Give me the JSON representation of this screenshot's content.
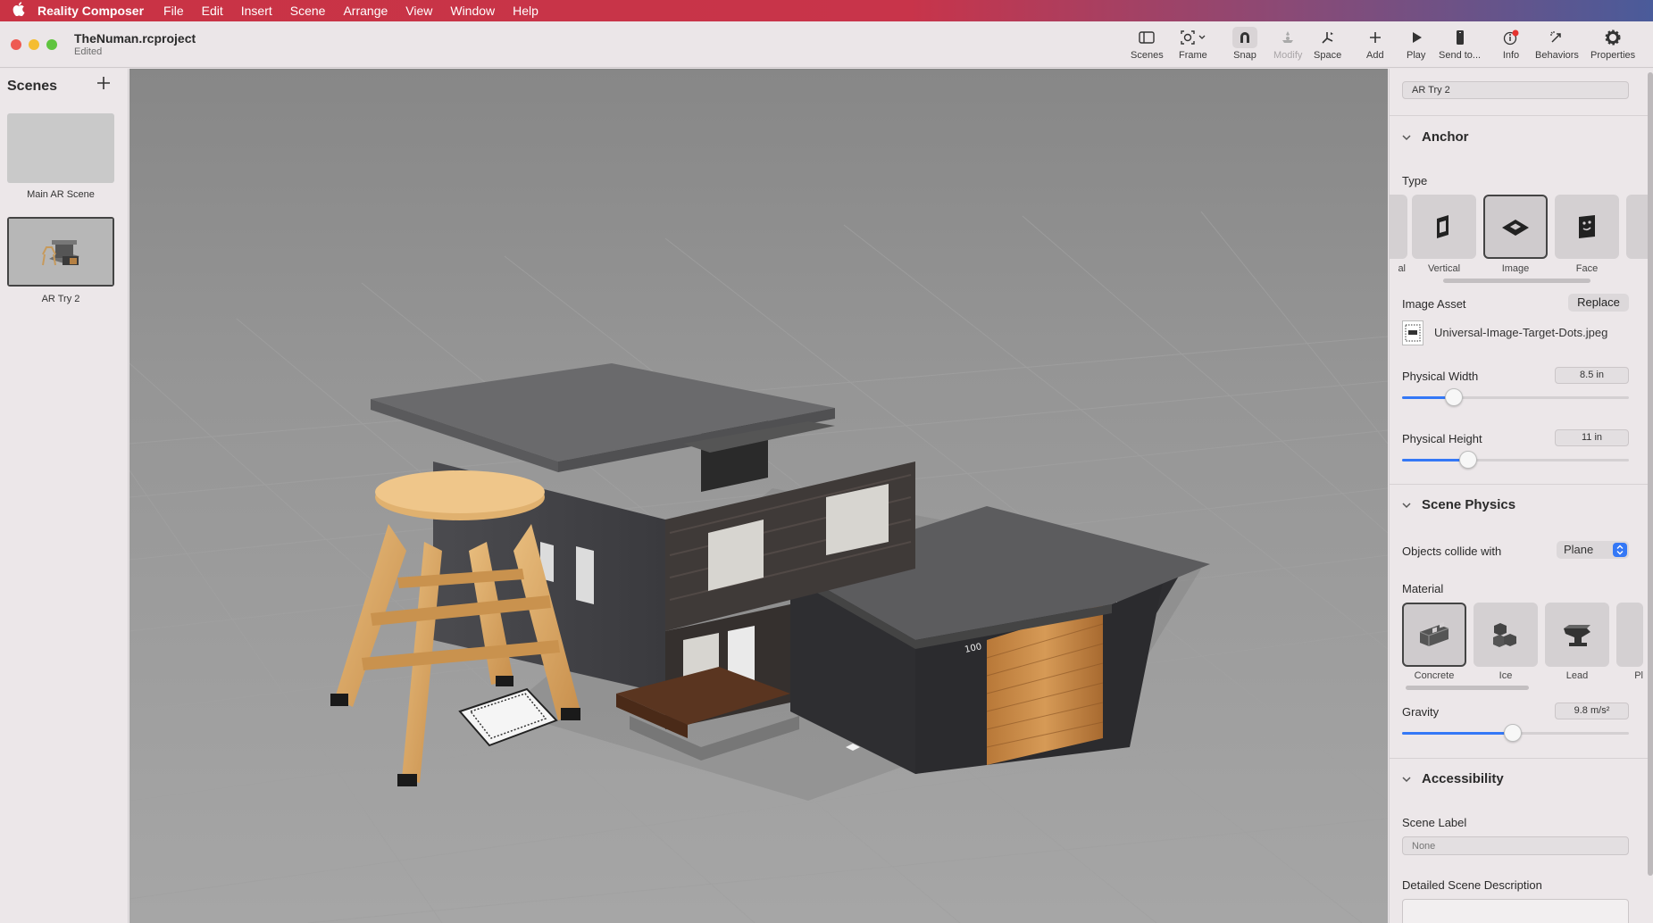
{
  "menubar": {
    "app_name": "Reality Composer",
    "items": [
      "File",
      "Edit",
      "Insert",
      "Scene",
      "Arrange",
      "View",
      "Window",
      "Help"
    ]
  },
  "window": {
    "title": "TheNuman.rcproject",
    "subtitle": "Edited"
  },
  "toolbar": {
    "scenes": "Scenes",
    "frame": "Frame",
    "snap": "Snap",
    "modify": "Modify",
    "space": "Space",
    "add": "Add",
    "play": "Play",
    "send_to": "Send to...",
    "info": "Info",
    "behaviors": "Behaviors",
    "properties": "Properties"
  },
  "sidebar": {
    "title": "Scenes",
    "scenes": [
      {
        "label": "Main AR Scene"
      },
      {
        "label": "AR Try 2"
      }
    ]
  },
  "viewport": {
    "house_number": "100"
  },
  "inspector": {
    "scene_name": "AR Try 2",
    "anchor": {
      "title": "Anchor",
      "type_label": "Type",
      "types": [
        {
          "label": "al"
        },
        {
          "label": "Vertical"
        },
        {
          "label": "Image"
        },
        {
          "label": "Face"
        }
      ],
      "image_asset_label": "Image Asset",
      "replace_button": "Replace",
      "image_file": "Universal-Image-Target-Dots.jpeg",
      "physical_width_label": "Physical Width",
      "physical_width_value": "8.5 in",
      "physical_width_fraction": 0.23,
      "physical_height_label": "Physical Height",
      "physical_height_value": "11 in",
      "physical_height_fraction": 0.29
    },
    "scene_physics": {
      "title": "Scene Physics",
      "collide_label": "Objects collide with",
      "collide_value": "Plane",
      "material_label": "Material",
      "materials": [
        {
          "label": "Concrete"
        },
        {
          "label": "Ice"
        },
        {
          "label": "Lead"
        },
        {
          "label": "Pl"
        }
      ],
      "gravity_label": "Gravity",
      "gravity_value": "9.8 m/s²",
      "gravity_fraction": 0.49
    },
    "accessibility": {
      "title": "Accessibility",
      "scene_label": "Scene Label",
      "scene_label_placeholder": "None",
      "description_label": "Detailed Scene Description"
    }
  }
}
